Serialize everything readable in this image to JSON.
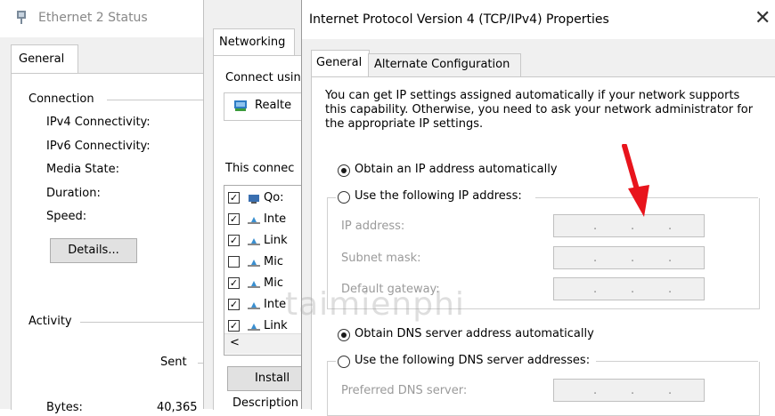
{
  "ethernet_status": {
    "title": "Ethernet 2 Status",
    "tab_general": "General",
    "connection_label": "Connection",
    "ipv4": "IPv4 Connectivity:",
    "ipv6": "IPv6 Connectivity:",
    "media_state": "Media State:",
    "duration": "Duration:",
    "speed": "Speed:",
    "details_button": "Details...",
    "activity_label": "Activity",
    "sent": "Sent",
    "bytes_label": "Bytes:",
    "bytes_value": "40,365"
  },
  "properties": {
    "tab_networking": "Networking",
    "connect_using": "Connect usin",
    "adapter": "Realte",
    "this_connection": "This connec",
    "items": [
      {
        "label": "Qo:",
        "checked": true
      },
      {
        "label": "Inte",
        "checked": true
      },
      {
        "label": "Link",
        "checked": true
      },
      {
        "label": "Mic",
        "checked": false
      },
      {
        "label": "Mic",
        "checked": true
      },
      {
        "label": "Inte",
        "checked": true
      },
      {
        "label": "Link",
        "checked": true
      }
    ],
    "scroll_left": "<",
    "install_button": "Install",
    "description_label": "Description"
  },
  "ipv4_props": {
    "title": "Internet Protocol Version 4 (TCP/IPv4) Properties",
    "close_glyph": "✕",
    "tab_general": "General",
    "tab_alternate": "Alternate Configuration",
    "description": "You can get IP settings assigned automatically if your network supports this capability. Otherwise, you need to ask your network administrator for the appropriate IP settings.",
    "obtain_ip_auto": "Obtain an IP address automatically",
    "use_following_ip": "Use the following IP address:",
    "ip_address_label": "IP address:",
    "subnet_mask_label": "Subnet mask:",
    "default_gateway_label": "Default gateway:",
    "obtain_dns_auto": "Obtain DNS server address automatically",
    "use_following_dns": "Use the following DNS server addresses:",
    "preferred_dns_label": "Preferred DNS server:",
    "ip_selected": "auto",
    "dns_selected": "auto"
  },
  "watermark": "taimienphi",
  "colors": {
    "arrow": "#e8141c",
    "disabled_text": "#9a9a9a"
  }
}
